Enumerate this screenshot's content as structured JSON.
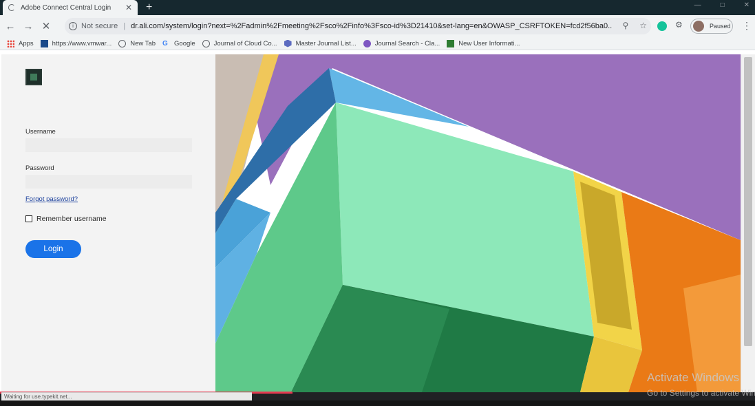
{
  "browser": {
    "tab_title": "Adobe Connect Central Login",
    "tab_close": "✕",
    "new_tab": "+",
    "url_security": "Not secure",
    "url": "dr.ali.com/system/login?next=%2Fadmin%2Fmeeting%2Fsco%2Finfo%3Fsco-id%3D21410&set-lang=en&OWASP_CSRFTOKEN=fcd2f56ba0...",
    "profile_label": "Paused"
  },
  "bookmarks": [
    {
      "label": "Apps",
      "icon": "apps-icon"
    },
    {
      "label": "https://www.vmwar...",
      "icon": "vmware-icon"
    },
    {
      "label": "New Tab",
      "icon": "globe-icon"
    },
    {
      "label": "Google",
      "icon": "google-icon"
    },
    {
      "label": "Journal of Cloud Co...",
      "icon": "globe-icon"
    },
    {
      "label": "Master Journal List...",
      "icon": "master-journal-icon"
    },
    {
      "label": "Journal Search - Cla...",
      "icon": "journal-search-icon"
    },
    {
      "label": "New User Informati...",
      "icon": "new-user-icon"
    }
  ],
  "login": {
    "username_label": "Username",
    "username_value": "",
    "password_label": "Password",
    "password_value": "",
    "forgot_label": "Forgot password?",
    "remember_label": "Remember username",
    "remember_checked": false,
    "login_button": "Login"
  },
  "status": {
    "text": "Waiting for use.typekit.net..."
  },
  "watermark": {
    "line1": "Activate Windows",
    "line2": "Go to Settings to activate Windows."
  },
  "colors": {
    "accent": "#1a73e8",
    "hero_purple": "#9a70bc",
    "hero_green": "#8de8b9",
    "hero_orange": "#ea7a16",
    "hero_yellow": "#f2d448",
    "hero_blue": "#63b6e6"
  }
}
